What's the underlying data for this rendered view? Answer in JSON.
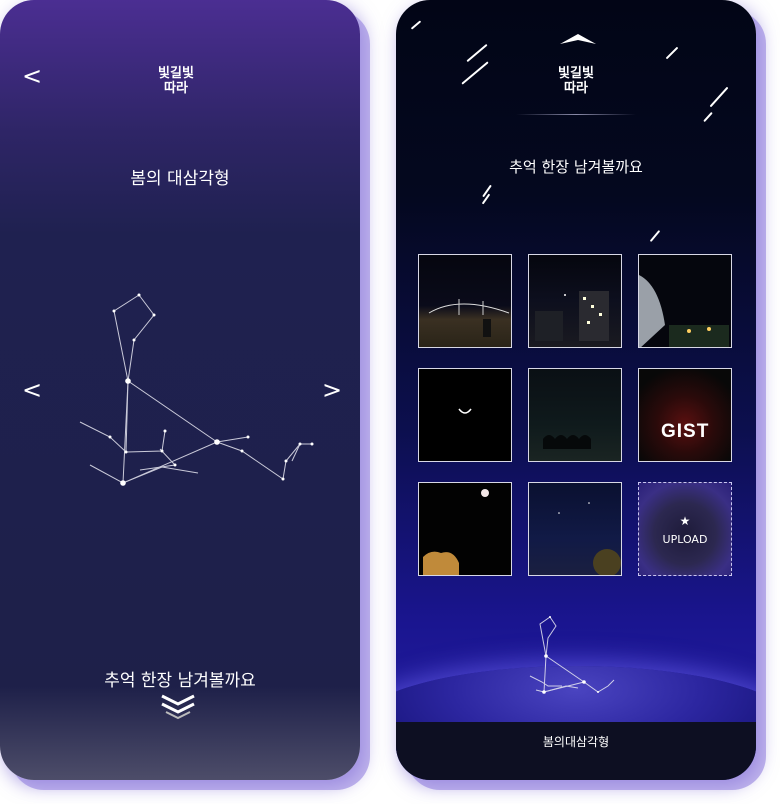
{
  "left_screen": {
    "back_icon": "<",
    "logo_lines": [
      "빛길빛",
      "따라"
    ],
    "constellation_title": "봄의 대삼각형",
    "prev_icon": "<",
    "next_icon": ">",
    "bottom_prompt": "추억 한장 남겨볼까요",
    "scroll_down_icon": "double-chevron-down"
  },
  "right_screen": {
    "scroll_up_icon": "chevron-up",
    "logo_lines": [
      "빛길빛",
      "따라"
    ],
    "prompt": "추억 한장 남겨볼까요",
    "photos": [
      {
        "name": "bridge-night"
      },
      {
        "name": "buildings-night"
      },
      {
        "name": "stadium-night"
      },
      {
        "name": "crescent-moon"
      },
      {
        "name": "dark-field"
      },
      {
        "name": "gist-sign",
        "caption": "GIST"
      },
      {
        "name": "moon-tree"
      },
      {
        "name": "starry-sky"
      }
    ],
    "upload_label": "UPLOAD",
    "footer_label": "봄의대삼각형"
  },
  "colors": {
    "left_top": "#4b2e92",
    "left_mid": "#1f2150",
    "right_top": "#020516",
    "right_bottom": "#231d9c",
    "shadow": "#8c78dc"
  }
}
